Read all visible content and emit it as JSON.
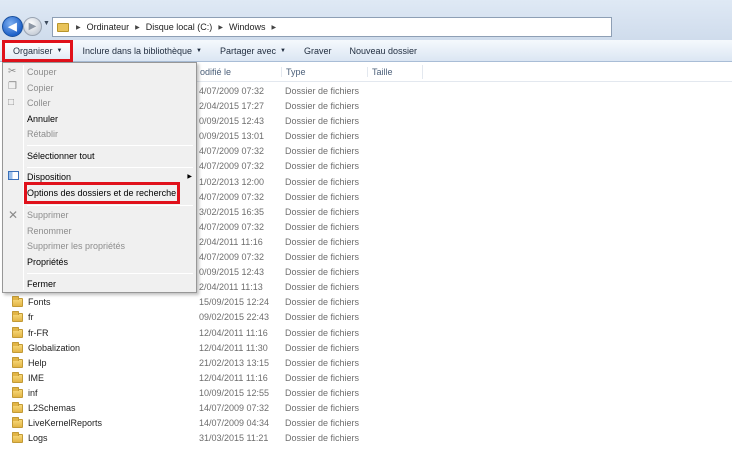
{
  "addressbar": {
    "crumbs": [
      "Ordinateur",
      "Disque local (C:)",
      "Windows"
    ]
  },
  "toolbar": {
    "organiser": "Organiser",
    "include": "Inclure dans la bibliothèque",
    "share": "Partager avec",
    "burn": "Graver",
    "new_folder": "Nouveau dossier"
  },
  "columns": {
    "modified": "odifié le",
    "type": "Type",
    "size": "Taille"
  },
  "menu": {
    "items": [
      {
        "label": "Couper",
        "enabled": false
      },
      {
        "label": "Copier",
        "enabled": false
      },
      {
        "label": "Coller",
        "enabled": false
      },
      {
        "label": "Annuler",
        "enabled": true
      },
      {
        "label": "Rétablir",
        "enabled": false
      },
      {
        "label": "Sélectionner tout",
        "enabled": true
      },
      {
        "label": "Disposition",
        "enabled": true
      },
      {
        "label": "Options des dossiers et de recherche",
        "enabled": true
      },
      {
        "label": "Supprimer",
        "enabled": false
      },
      {
        "label": "Renommer",
        "enabled": false
      },
      {
        "label": "Supprimer les propriétés",
        "enabled": false
      },
      {
        "label": "Propriétés",
        "enabled": true
      },
      {
        "label": "Fermer",
        "enabled": true
      }
    ]
  },
  "files": [
    {
      "name": "",
      "date": "4/07/2009 07:32",
      "type": "Dossier de fichiers"
    },
    {
      "name": "",
      "date": "2/04/2015 17:27",
      "type": "Dossier de fichiers"
    },
    {
      "name": "",
      "date": "0/09/2015 12:43",
      "type": "Dossier de fichiers"
    },
    {
      "name": "",
      "date": "0/09/2015 13:01",
      "type": "Dossier de fichiers"
    },
    {
      "name": "",
      "date": "4/07/2009 07:32",
      "type": "Dossier de fichiers"
    },
    {
      "name": "",
      "date": "4/07/2009 07:32",
      "type": "Dossier de fichiers"
    },
    {
      "name": "",
      "date": "1/02/2013 12:00",
      "type": "Dossier de fichiers"
    },
    {
      "name": "",
      "date": "4/07/2009 07:32",
      "type": "Dossier de fichiers"
    },
    {
      "name": "",
      "date": "3/02/2015 16:35",
      "type": "Dossier de fichiers"
    },
    {
      "name": "",
      "date": "4/07/2009 07:32",
      "type": "Dossier de fichiers"
    },
    {
      "name": "",
      "date": "2/04/2011 11:16",
      "type": "Dossier de fichiers"
    },
    {
      "name": "",
      "date": "4/07/2009 07:32",
      "type": "Dossier de fichiers"
    },
    {
      "name": "",
      "date": "0/09/2015 12:43",
      "type": "Dossier de fichiers"
    },
    {
      "name": "",
      "date": "2/04/2011 11:13",
      "type": "Dossier de fichiers"
    },
    {
      "name": "Fonts",
      "date": "15/09/2015 12:24",
      "type": "Dossier de fichiers"
    },
    {
      "name": "fr",
      "date": "09/02/2015 22:43",
      "type": "Dossier de fichiers"
    },
    {
      "name": "fr-FR",
      "date": "12/04/2011 11:16",
      "type": "Dossier de fichiers"
    },
    {
      "name": "Globalization",
      "date": "12/04/2011 11:30",
      "type": "Dossier de fichiers"
    },
    {
      "name": "Help",
      "date": "21/02/2013 13:15",
      "type": "Dossier de fichiers"
    },
    {
      "name": "IME",
      "date": "12/04/2011 11:16",
      "type": "Dossier de fichiers"
    },
    {
      "name": "inf",
      "date": "10/09/2015 12:55",
      "type": "Dossier de fichiers"
    },
    {
      "name": "L2Schemas",
      "date": "14/07/2009 07:32",
      "type": "Dossier de fichiers"
    },
    {
      "name": "LiveKernelReports",
      "date": "14/07/2009 04:34",
      "type": "Dossier de fichiers"
    },
    {
      "name": "Logs",
      "date": "31/03/2015 11:21",
      "type": "Dossier de fichiers"
    }
  ],
  "colors": {
    "highlight_red": "#e0111b",
    "toolbar_bg": "#dbe6f3",
    "menu_bg": "#f0f0f0"
  }
}
